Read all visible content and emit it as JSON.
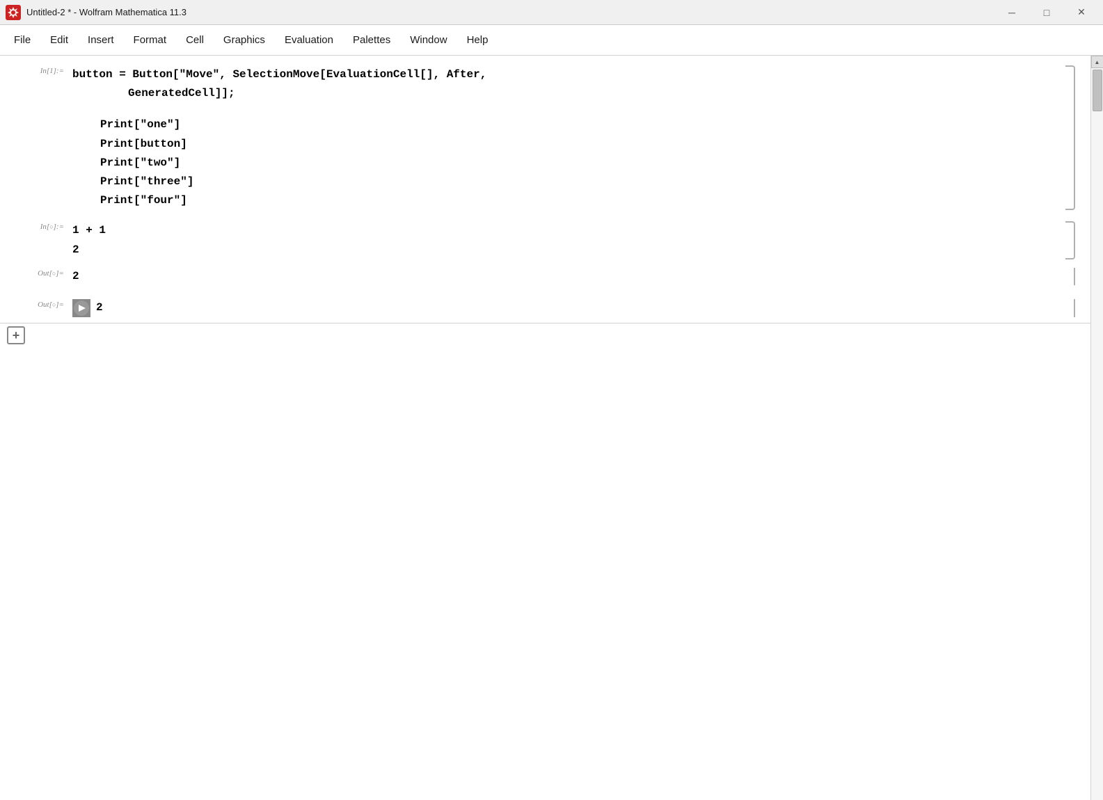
{
  "window": {
    "title": "Untitled-2 * - Wolfram Mathematica 11.3",
    "controls": {
      "minimize": "─",
      "restore": "□",
      "close": "✕"
    }
  },
  "menubar": {
    "items": [
      {
        "label": "File",
        "id": "file"
      },
      {
        "label": "Edit",
        "id": "edit"
      },
      {
        "label": "Insert",
        "id": "insert"
      },
      {
        "label": "Format",
        "id": "format"
      },
      {
        "label": "Cell",
        "id": "cell"
      },
      {
        "label": "Graphics",
        "id": "graphics"
      },
      {
        "label": "Evaluation",
        "id": "evaluation"
      },
      {
        "label": "Palettes",
        "id": "palettes"
      },
      {
        "label": "Window",
        "id": "window"
      },
      {
        "label": "Help",
        "id": "help"
      }
    ]
  },
  "notebook": {
    "cells": [
      {
        "id": "cell1",
        "in_label": "In[1]:=",
        "type": "input",
        "lines": [
          "button = Button[\"Move\", SelectionMove[EvaluationCell[], After,",
          "        GeneratedCell]];"
        ]
      },
      {
        "id": "cell1b",
        "type": "input_continuation",
        "lines": [
          "Print[\"one\"]",
          "Print[button]",
          "Print[\"two\"]",
          "Print[\"three\"]",
          "Print[\"four\"]"
        ]
      },
      {
        "id": "cell2",
        "in_label": "In[○]:=",
        "type": "input",
        "lines": [
          "1 + 1",
          "2"
        ]
      },
      {
        "id": "cell3",
        "out_label": "Out[○]=",
        "type": "output",
        "value": "2"
      },
      {
        "id": "cell4",
        "out_label": "Out[○]=",
        "type": "output_arrow",
        "value": "2"
      }
    ],
    "add_button_label": "+"
  }
}
